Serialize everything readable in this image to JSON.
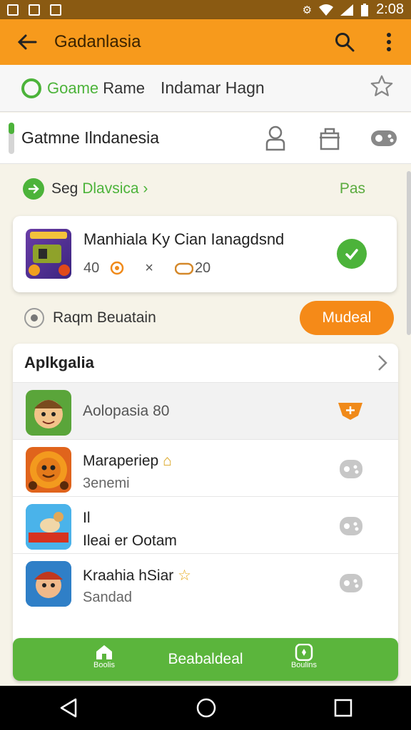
{
  "status_bar": {
    "time": "2:08"
  },
  "app_bar": {
    "title": "Gadanlasia",
    "back_icon": "arrow-left-icon",
    "search_icon": "search-icon",
    "menu_icon": "more-vertical-icon"
  },
  "row1": {
    "chip_highlight": "Goame",
    "chip_rest": " Rame",
    "subtitle": "Indamar Hagn"
  },
  "row2": {
    "heading": "Gatmne Ilndanesia"
  },
  "section": {
    "label_prefix": "Seg ",
    "label_highlight": "Dlavsica",
    "right_label": "Pas"
  },
  "featured_card": {
    "title": "Manhiala Ky Cian Ianagdsnd",
    "meta_count": "40",
    "meta_x": "×",
    "meta_tag": "20"
  },
  "radio_row": {
    "label": "Raqm Beuatain",
    "pill_label": "Mudeal"
  },
  "list": {
    "header": "Aplkgalia",
    "items": [
      {
        "name": "Aolopasia 80",
        "sub": ""
      },
      {
        "name": "Maraperiep",
        "sub": "3enemi"
      },
      {
        "name": "Il",
        "sub": "Ileai er Ootam"
      },
      {
        "name": "Kraahia hSiar",
        "sub": "Sandad"
      }
    ]
  },
  "bottom_bar": {
    "left_tab": "Boolis",
    "center_label": "Beabaldeal",
    "right_tab": "Boulins"
  },
  "colors": {
    "accent_orange": "#f79a1c",
    "accent_green": "#4cb33a",
    "bottom_green": "#5bb53c"
  }
}
